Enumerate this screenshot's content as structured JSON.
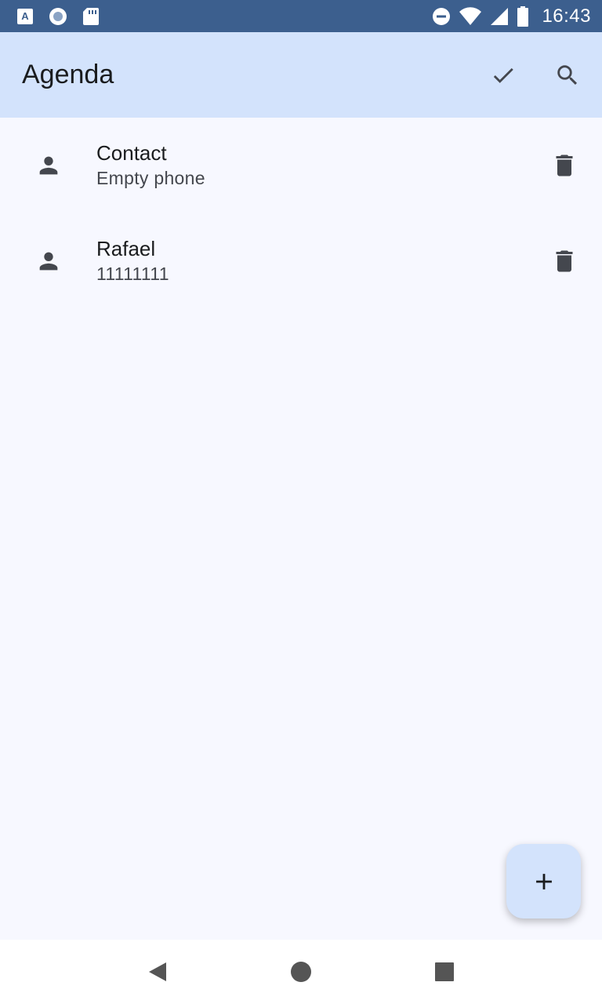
{
  "status_bar": {
    "time": "16:43",
    "icons_left": [
      "app-a-icon",
      "circle-record-icon",
      "sd-card-icon"
    ],
    "icons_right": [
      "do-not-disturb-icon",
      "wifi-icon",
      "cell-signal-icon",
      "battery-icon"
    ]
  },
  "app_bar": {
    "title": "Agenda",
    "actions": [
      "check-icon",
      "search-icon"
    ],
    "background": "#d3e3fc"
  },
  "contacts": [
    {
      "name": "Contact",
      "phone": "Empty phone",
      "icon": "person-icon",
      "action": "delete-icon"
    },
    {
      "name": "Rafael",
      "phone": "11111111",
      "icon": "person-icon",
      "action": "delete-icon"
    }
  ],
  "fab": {
    "icon": "add-icon"
  },
  "nav_bar": {
    "buttons": [
      "back-icon",
      "home-icon",
      "recents-icon"
    ]
  },
  "colors": {
    "status_bar": "#3c5f8e",
    "background": "#f7f8ff",
    "icon": "#44474e"
  }
}
